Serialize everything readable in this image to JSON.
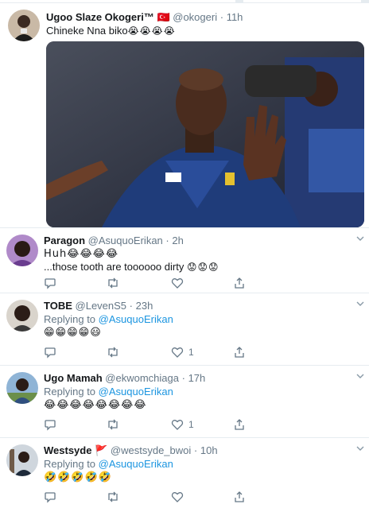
{
  "original_tweet": {
    "display_name": "Ugoo Slaze Okogeri™",
    "flag": "🇹🇷",
    "handle": "@okogeri",
    "separator": "·",
    "time": "11h",
    "text": "Chineke Nna biko",
    "emojis": "😭😭😭😭"
  },
  "replies": [
    {
      "display_name": "Paragon",
      "handle": "@AsuquoErikan",
      "separator": "·",
      "time": "2h",
      "line1": "Huh😂😂😂😂",
      "line2": "...those tooth are toooooo dirty",
      "line2_emojis": "😟😟😟",
      "like_count": ""
    },
    {
      "display_name": "TOBE",
      "handle": "@LevenS5",
      "separator": "·",
      "time": "23h",
      "replying_prefix": "Replying to",
      "replying_to": "@AsuquoErikan",
      "text": "😁😁😁😁😃",
      "like_count": "1"
    },
    {
      "display_name": "Ugo Mamah",
      "handle": "@ekwomchiaga",
      "separator": "·",
      "time": "17h",
      "replying_prefix": "Replying to",
      "replying_to": "@AsuquoErikan",
      "text": "😂😂😂😂😂😂😂😂",
      "like_count": "1"
    },
    {
      "display_name": "Westsyde",
      "flag": "🚩",
      "handle": "@westsyde_bwoi",
      "separator": "·",
      "time": "10h",
      "replying_prefix": "Replying to",
      "replying_to": "@AsuquoErikan",
      "text": "🤣🤣🤣🤣🤣",
      "like_count": ""
    }
  ],
  "icons": {
    "reply": "reply-icon",
    "retweet": "retweet-icon",
    "like": "heart-icon",
    "share": "share-icon",
    "more": "chevron-down-icon"
  },
  "colors": {
    "link": "#1b95e0",
    "muted": "#657786",
    "divider": "#e6ecf0"
  }
}
